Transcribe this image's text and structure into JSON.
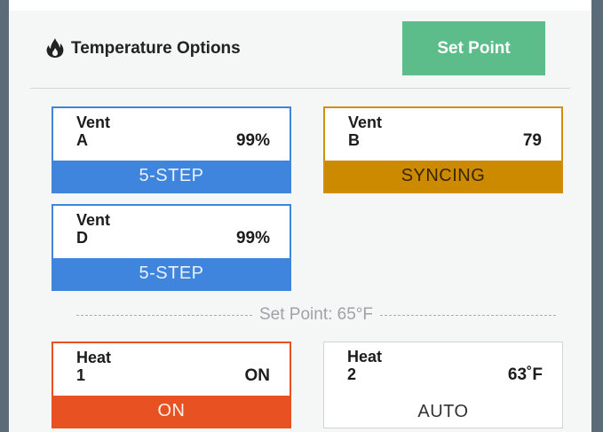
{
  "header": {
    "title": "Temperature Options",
    "title_icon": "flame-icon",
    "set_point_button": "Set Point"
  },
  "colors": {
    "accent_green": "#5cbd8a",
    "step_blue": "#3f84dd",
    "syncing_gold": "#cc8a00",
    "on_orange": "#e85222"
  },
  "vents": [
    {
      "name_line1": "Vent",
      "name_line2": "A",
      "value": "99%",
      "status": "5-STEP"
    },
    {
      "name_line1": "Vent",
      "name_line2": "B",
      "value": "79",
      "status": "SYNCING"
    },
    {
      "name_line1": "Vent",
      "name_line2": "D",
      "value": "99%",
      "status": "5-STEP"
    }
  ],
  "set_point_line": "Set Point: 65°F",
  "heaters": [
    {
      "name_line1": "Heat",
      "name_line2": "1",
      "value": "ON",
      "status": "ON"
    },
    {
      "name_line1": "Heat",
      "name_line2": "2",
      "value": "63˚F",
      "status": "AUTO"
    }
  ]
}
